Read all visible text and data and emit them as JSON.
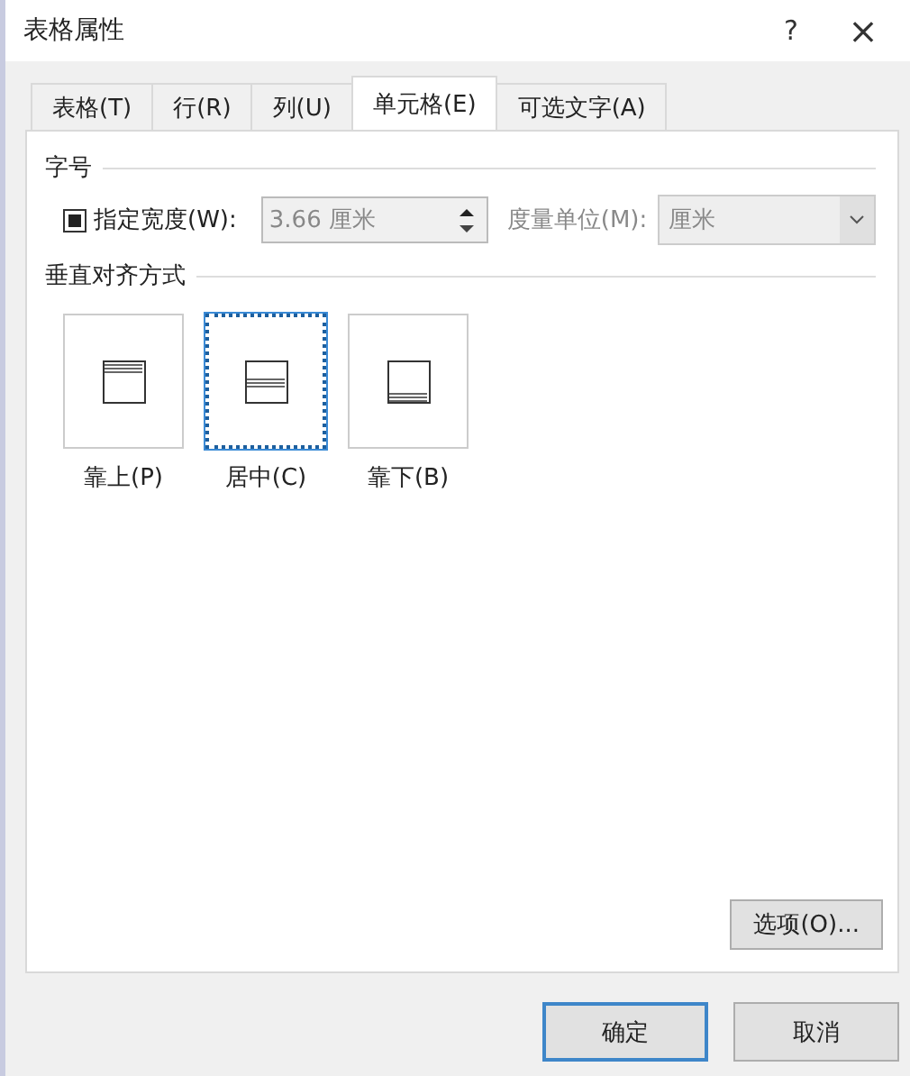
{
  "window": {
    "title": "表格属性",
    "help": "?",
    "close": "×"
  },
  "tabs": [
    {
      "label": "表格(T)",
      "selected": false
    },
    {
      "label": "行(R)",
      "selected": false
    },
    {
      "label": "列(U)",
      "selected": false
    },
    {
      "label": "单元格(E)",
      "selected": true
    },
    {
      "label": "可选文字(A)",
      "selected": false
    }
  ],
  "size_section": {
    "title": "字号",
    "width_checkbox": {
      "label": "指定宽度(W):",
      "checked": true
    },
    "width_field": {
      "value": "3.66 厘米",
      "disabled": true
    },
    "unit_label": "度量单位(M):",
    "unit_dropdown": {
      "value": "厘米",
      "disabled": true
    }
  },
  "align_section": {
    "title": "垂直对齐方式",
    "options": [
      {
        "kind": "top",
        "label": "靠上(P)",
        "selected": false
      },
      {
        "kind": "center",
        "label": "居中(C)",
        "selected": true
      },
      {
        "kind": "bottom",
        "label": "靠下(B)",
        "selected": false
      }
    ]
  },
  "options_button": "选项(O)...",
  "buttons": [
    {
      "label": "确定",
      "default": true
    },
    {
      "label": "取消",
      "default": false
    }
  ]
}
